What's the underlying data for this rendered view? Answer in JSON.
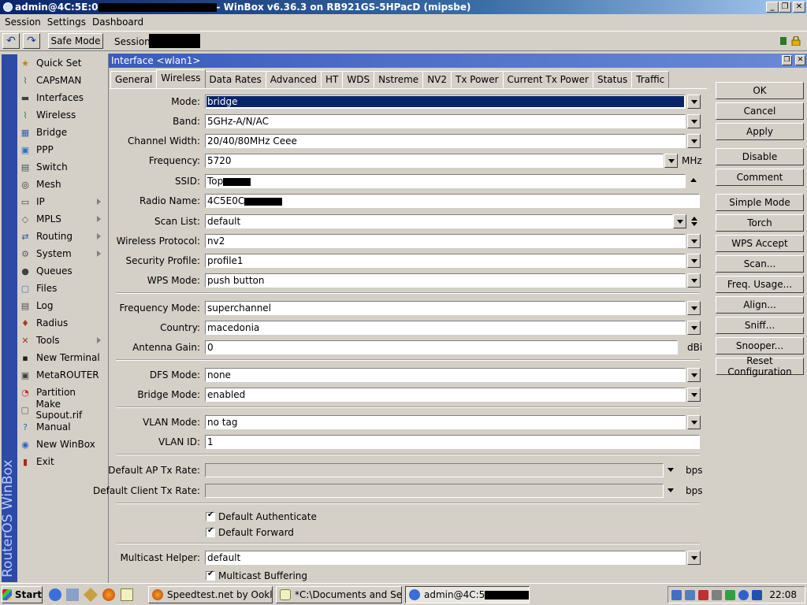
{
  "window": {
    "title_prefix": "admin@4C:5E:0",
    "title_suffix": " - WinBox v6.36.3 on RB921GS-5HPacD (mipsbe)",
    "min_label": "_",
    "max_label": "❐",
    "close_label": "✕"
  },
  "menubar": {
    "items": [
      "Session",
      "Settings",
      "Dashboard"
    ]
  },
  "toolbar": {
    "undo_label": "↶",
    "redo_label": "↷",
    "safe_mode_label": "Safe Mode",
    "session_label": "Session:"
  },
  "leftbar": {
    "text": "RouterOS WinBox"
  },
  "sidebar": {
    "items": [
      {
        "label": "Quick Set",
        "icon": "quick-set-icon",
        "submenu": false
      },
      {
        "label": "CAPsMAN",
        "icon": "capsman-icon",
        "submenu": false
      },
      {
        "label": "Interfaces",
        "icon": "interfaces-icon",
        "submenu": false
      },
      {
        "label": "Wireless",
        "icon": "wireless-icon",
        "submenu": false
      },
      {
        "label": "Bridge",
        "icon": "bridge-icon",
        "submenu": false
      },
      {
        "label": "PPP",
        "icon": "ppp-icon",
        "submenu": false
      },
      {
        "label": "Switch",
        "icon": "switch-icon",
        "submenu": false
      },
      {
        "label": "Mesh",
        "icon": "mesh-icon",
        "submenu": false
      },
      {
        "label": "IP",
        "icon": "ip-icon",
        "submenu": true
      },
      {
        "label": "MPLS",
        "icon": "mpls-icon",
        "submenu": true
      },
      {
        "label": "Routing",
        "icon": "routing-icon",
        "submenu": true
      },
      {
        "label": "System",
        "icon": "system-icon",
        "submenu": true
      },
      {
        "label": "Queues",
        "icon": "queues-icon",
        "submenu": false
      },
      {
        "label": "Files",
        "icon": "files-icon",
        "submenu": false
      },
      {
        "label": "Log",
        "icon": "log-icon",
        "submenu": false
      },
      {
        "label": "Radius",
        "icon": "radius-icon",
        "submenu": false
      },
      {
        "label": "Tools",
        "icon": "tools-icon",
        "submenu": true
      },
      {
        "label": "New Terminal",
        "icon": "terminal-icon",
        "submenu": false
      },
      {
        "label": "MetaROUTER",
        "icon": "metarouter-icon",
        "submenu": false
      },
      {
        "label": "Partition",
        "icon": "partition-icon",
        "submenu": false
      },
      {
        "label": "Make Supout.rif",
        "icon": "supout-icon",
        "submenu": false
      },
      {
        "label": "Manual",
        "icon": "manual-icon",
        "submenu": false
      },
      {
        "label": "New WinBox",
        "icon": "winbox-icon",
        "submenu": false
      },
      {
        "label": "Exit",
        "icon": "exit-icon",
        "submenu": false
      }
    ]
  },
  "interface_window": {
    "title": "Interface <wlan1>",
    "tabs": [
      "General",
      "Wireless",
      "Data Rates",
      "Advanced",
      "HT",
      "WDS",
      "Nstreme",
      "NV2",
      "Tx Power",
      "Current Tx Power",
      "Status",
      "Traffic"
    ],
    "active_tab": "Wireless",
    "fields": {
      "mode": {
        "label": "Mode:",
        "value": "bridge"
      },
      "band": {
        "label": "Band:",
        "value": "5GHz-A/N/AC"
      },
      "channel_width": {
        "label": "Channel Width:",
        "value": "20/40/80MHz Ceee"
      },
      "frequency": {
        "label": "Frequency:",
        "value": "5720",
        "unit": "MHz"
      },
      "ssid": {
        "label": "SSID:",
        "value": "Top"
      },
      "radio_name": {
        "label": "Radio Name:",
        "value": "4C5E0C"
      },
      "scan_list": {
        "label": "Scan List:",
        "value": "default"
      },
      "wireless_protocol": {
        "label": "Wireless Protocol:",
        "value": "nv2"
      },
      "security_profile": {
        "label": "Security Profile:",
        "value": "profile1"
      },
      "wps_mode": {
        "label": "WPS Mode:",
        "value": "push button"
      },
      "frequency_mode": {
        "label": "Frequency Mode:",
        "value": "superchannel"
      },
      "country": {
        "label": "Country:",
        "value": "macedonia"
      },
      "antenna_gain": {
        "label": "Antenna Gain:",
        "value": "0",
        "unit": "dBi"
      },
      "dfs_mode": {
        "label": "DFS Mode:",
        "value": "none"
      },
      "bridge_mode": {
        "label": "Bridge Mode:",
        "value": "enabled"
      },
      "vlan_mode": {
        "label": "VLAN Mode:",
        "value": "no tag"
      },
      "vlan_id": {
        "label": "VLAN ID:",
        "value": "1"
      },
      "default_ap_tx_rate": {
        "label": "Default AP Tx Rate:",
        "value": "",
        "unit": "bps"
      },
      "default_client_tx_rate": {
        "label": "Default Client Tx Rate:",
        "value": "",
        "unit": "bps"
      },
      "multicast_helper": {
        "label": "Multicast Helper:",
        "value": "default"
      }
    },
    "checkboxes": {
      "default_authenticate": {
        "label": "Default Authenticate",
        "checked": true
      },
      "default_forward": {
        "label": "Default Forward",
        "checked": true
      },
      "multicast_buffering": {
        "label": "Multicast Buffering",
        "checked": true
      }
    },
    "buttons": [
      "OK",
      "Cancel",
      "Apply",
      "Disable",
      "Comment",
      "Simple Mode",
      "Torch",
      "WPS Accept",
      "Scan...",
      "Freq. Usage...",
      "Align...",
      "Sniff...",
      "Snooper...",
      "Reset Configuration"
    ]
  },
  "taskbar": {
    "start_label": "Start",
    "tasks": [
      "Speedtest.net by Ookla ...",
      "*C:\\Documents and Setti...",
      "admin@4C:5"
    ],
    "clock": "22:08"
  },
  "colors": {
    "selection": "#0a246a",
    "leftbar": "#2c4aa6",
    "titlebar": "#0a246a",
    "face": "#d4d0c8"
  }
}
